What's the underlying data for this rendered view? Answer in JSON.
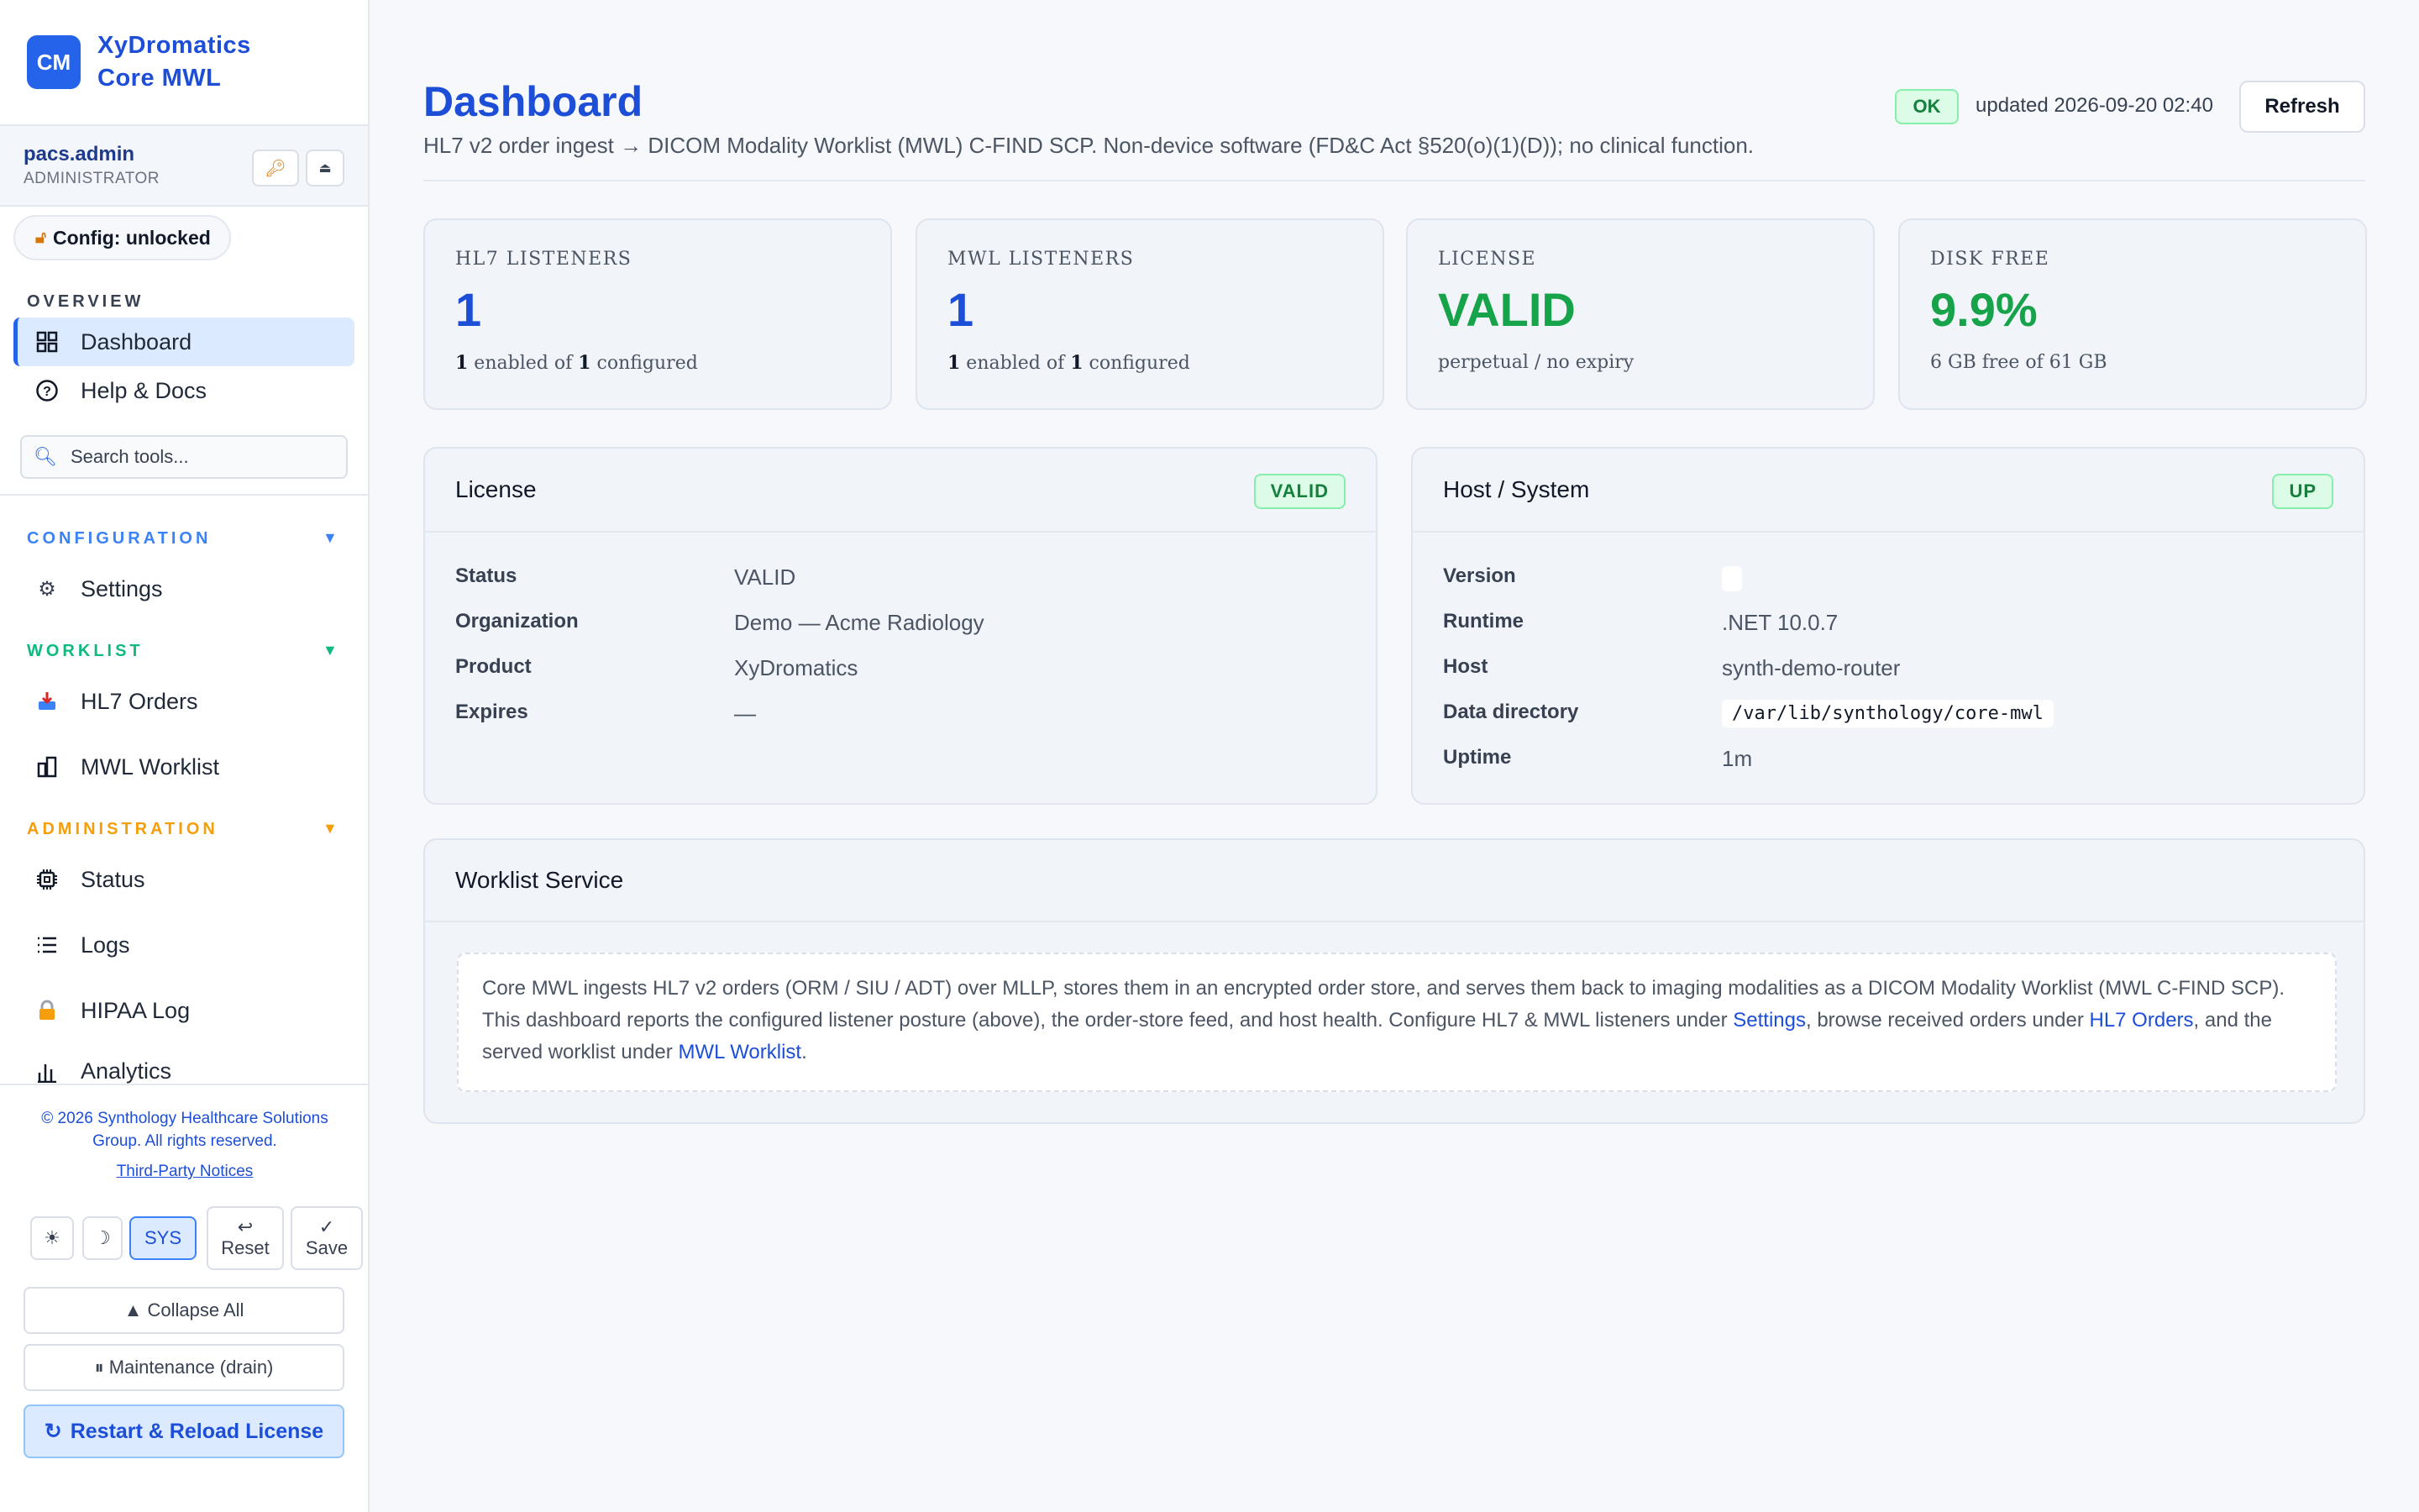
{
  "brand": {
    "logo": "CM",
    "line1": "XyDromatics",
    "line2": "Core MWL"
  },
  "user": {
    "name": "pacs.admin",
    "role": "ADMINISTRATOR"
  },
  "config_status": "Config: unlocked",
  "sections": {
    "overview": "OVERVIEW",
    "configuration": "CONFIGURATION",
    "worklist": "WORKLIST",
    "administration": "ADMINISTRATION"
  },
  "section_colors": {
    "overview": "#374151",
    "configuration": "#3b82f6",
    "worklist": "#10b981",
    "administration": "#f59e0b"
  },
  "nav": {
    "dashboard": "Dashboard",
    "help": "Help & Docs",
    "settings": "Settings",
    "hl7_orders": "HL7 Orders",
    "mwl_worklist": "MWL Worklist",
    "status": "Status",
    "logs": "Logs",
    "hipaa_log": "HIPAA Log",
    "analytics": "Analytics"
  },
  "search": {
    "placeholder": "Search tools..."
  },
  "footer": {
    "copyright": "© 2026 Synthology Healthcare Solutions Group. All rights reserved.",
    "notices_link": "Third-Party Notices",
    "theme_sys": "SYS",
    "reset": "Reset",
    "save": "Save",
    "collapse_all": "▲ Collapse All",
    "maintenance": "⏸ Maintenance (drain)",
    "restart": "Restart & Reload License"
  },
  "header": {
    "title": "Dashboard",
    "subtitle": "HL7 v2 order ingest → DICOM Modality Worklist (MWL) C-FIND SCP. Non-device software (FD&C Act §520(o)(1)(D)); no clinical function.",
    "status_badge": "OK",
    "updated": "updated 2026-09-20 02:40",
    "refresh": "Refresh"
  },
  "stats": [
    {
      "label": "HL7 LISTENERS",
      "value": "1",
      "enabled": "1",
      "mid": " enabled of ",
      "configured": "1",
      "tail": " configured"
    },
    {
      "label": "MWL LISTENERS",
      "value": "1",
      "enabled": "1",
      "mid": " enabled of ",
      "configured": "1",
      "tail": " configured"
    },
    {
      "label": "LICENSE",
      "value": "VALID",
      "note": "perpetual / no expiry"
    },
    {
      "label": "DISK FREE",
      "value": "9.9%",
      "note": "6 GB free of 61 GB"
    }
  ],
  "license_card": {
    "title": "License",
    "badge": "VALID",
    "rows": [
      {
        "key": "Status",
        "value": "VALID"
      },
      {
        "key": "Organization",
        "value": "Demo — Acme Radiology"
      },
      {
        "key": "Product",
        "value": "XyDromatics"
      },
      {
        "key": "Expires",
        "value": "—"
      }
    ]
  },
  "host_card": {
    "title": "Host / System",
    "badge": "UP",
    "rows": [
      {
        "key": "Version",
        "value": ""
      },
      {
        "key": "Runtime",
        "value": ".NET 10.0.7"
      },
      {
        "key": "Host",
        "value": "synth-demo-router"
      },
      {
        "key": "Data directory",
        "value": "/var/lib/synthology/core-mwl"
      },
      {
        "key": "Uptime",
        "value": "1m"
      }
    ]
  },
  "worklist_card": {
    "title": "Worklist Service",
    "text1": "Core MWL ingests HL7 v2 orders (ORM / SIU / ADT) over MLLP, stores them in an encrypted order store, and serves them back to imaging modalities as a DICOM Modality Worklist (MWL C-FIND SCP). This dashboard reports the configured listener posture (above), the order-store feed, and host health. Configure HL7 & MWL listeners under ",
    "link1": "Settings",
    "text2": ", browse received orders under ",
    "link2": "HL7 Orders",
    "text3": ", and the served worklist under ",
    "link3": "MWL Worklist",
    "text4": "."
  }
}
